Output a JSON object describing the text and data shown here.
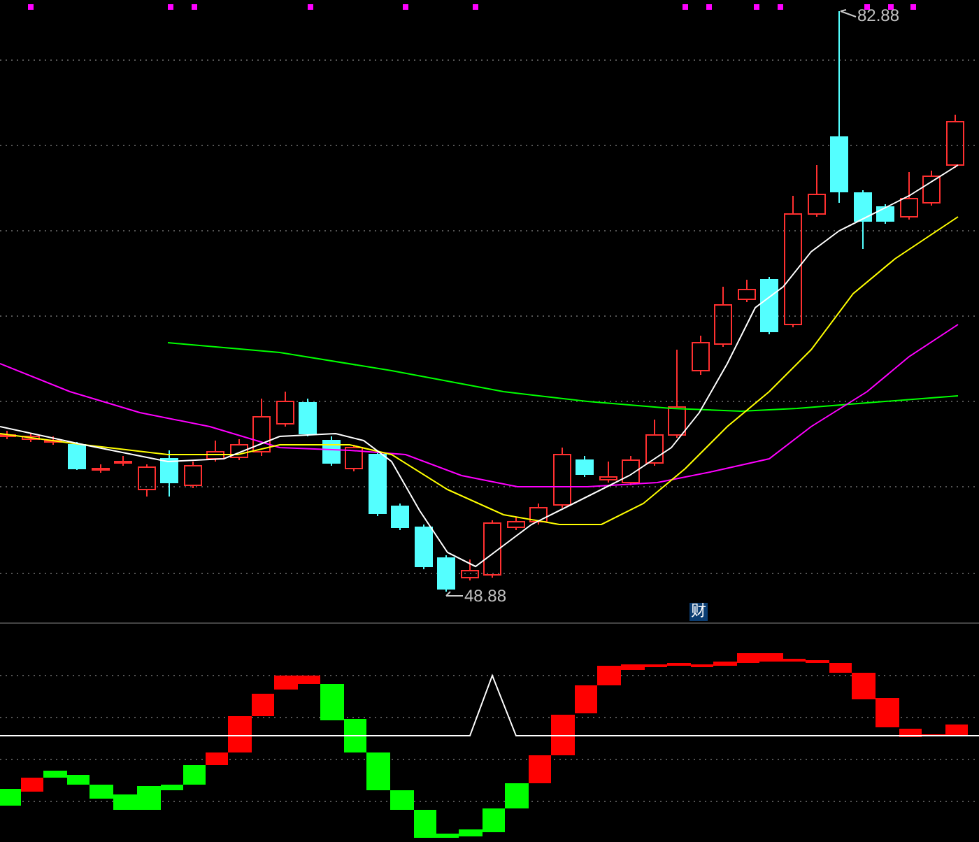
{
  "main_chart": {
    "high_label": "82.88",
    "low_label": "48.88",
    "badge": "财"
  }
}
